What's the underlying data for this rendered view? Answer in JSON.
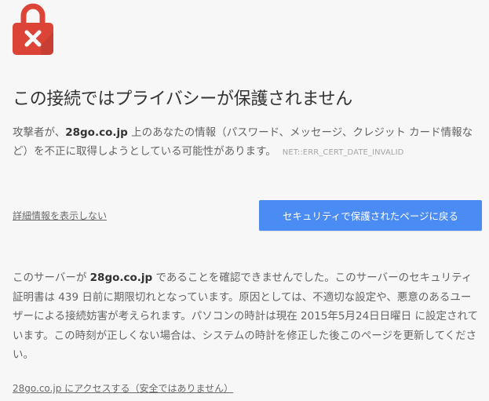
{
  "page": {
    "lock_icon": "red-lock-with-x-icon",
    "accent_color": "#4b8bf4",
    "error_color": "#db4437"
  },
  "headline": "この接続ではプライバシーが保護されません",
  "summary": {
    "prefix": "攻撃者が、",
    "host": "28go.co.jp",
    "suffix": " 上のあなたの情報（パスワード、メッセージ、クレジット カード情報など）を不正に取得しようとしている可能性があります。",
    "error_code": "NET::ERR_CERT_DATE_INVALID"
  },
  "actions": {
    "details_toggle": "詳細情報を表示しない",
    "back_to_safety": "セキュリティで保護されたページに戻る"
  },
  "details": {
    "prefix": "このサーバーが ",
    "host": "28go.co.jp",
    "suffix": " であることを確認できませんでした。このサーバーのセキュリティ証明書は 439 日前に期限切れとなっています。原因としては、不適切な設定や、悪意のあるユーザーによる接続妨害が考えられます。パソコンの時計は現在 2015年5月24日日曜日 に設定されています。この時刻が正しくない場合は、システムの時計を修正した後このページを更新してください。"
  },
  "proceed_link": "28go.co.jp にアクセスする（安全ではありません）"
}
